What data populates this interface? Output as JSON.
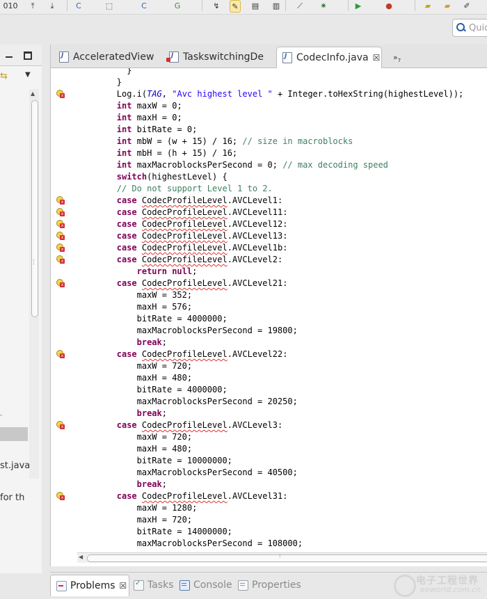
{
  "toolbar": {
    "items": [
      {
        "icon": "binary-icon",
        "glyph": "010"
      },
      {
        "icon": "upload-icon",
        "glyph": "⤒"
      },
      {
        "icon": "download-icon",
        "glyph": "⤓"
      },
      {
        "icon": "new-class-icon",
        "glyph": "C"
      },
      {
        "icon": "open-type-icon",
        "glyph": "⬚"
      },
      {
        "icon": "new-file-icon",
        "glyph": "C"
      },
      {
        "icon": "refresh-icon",
        "glyph": "G"
      },
      {
        "icon": "debug-step-icon",
        "glyph": "↯"
      },
      {
        "icon": "highlight-pen-icon",
        "glyph": "✎"
      },
      {
        "icon": "page-icon",
        "glyph": "▤"
      },
      {
        "icon": "stack-icon",
        "glyph": "▥"
      },
      {
        "icon": "pin-icon",
        "glyph": "⟋"
      },
      {
        "icon": "bug-icon",
        "glyph": "✷"
      },
      {
        "icon": "run-icon",
        "glyph": "▶"
      },
      {
        "icon": "stop-icon",
        "glyph": "●"
      },
      {
        "icon": "open-folder-icon",
        "glyph": "▰"
      },
      {
        "icon": "open-folder-alt-icon",
        "glyph": "▰"
      },
      {
        "icon": "edit-pencil-icon",
        "glyph": "✐"
      }
    ],
    "quick_access_placeholder": "Quic"
  },
  "left_view": {
    "item_truncated_1": "st.java",
    "item_truncated_2": "for th",
    "blue_mark": "-"
  },
  "editor": {
    "tabs": [
      {
        "label": "AcceleratedView",
        "error": false
      },
      {
        "label": "TaskswitchingDe",
        "error": true
      },
      {
        "label": "CodecInfo.java",
        "error": false,
        "active": true
      }
    ],
    "close_glyph": "☒",
    "overflow_label": "»",
    "overflow_count": "7",
    "lines": [
      {
        "indent": 10,
        "text": "        }"
      },
      {
        "indent": 8,
        "text": "}"
      },
      {
        "indent": 8,
        "marker": true,
        "html": "Log.i(<span class='it'>TAG</span>, <span class='st'>\"Avc highest level \"</span> + Integer.toHexString(highestLevel));"
      },
      {
        "indent": 8,
        "html": "<span class='kw'>int</span> maxW = 0;"
      },
      {
        "indent": 8,
        "html": "<span class='kw'>int</span> maxH = 0;"
      },
      {
        "indent": 8,
        "html": "<span class='kw'>int</span> bitRate = 0;"
      },
      {
        "indent": 8,
        "html": "<span class='kw'>int</span> mbW = (w + 15) / 16; <span class='cm'>// size in macroblocks</span>"
      },
      {
        "indent": 8,
        "html": "<span class='kw'>int</span> mbH = (h + 15) / 16;"
      },
      {
        "indent": 8,
        "html": "<span class='kw'>int</span> maxMacroblocksPerSecond = 0; <span class='cm'>// max decoding speed</span>"
      },
      {
        "indent": 8,
        "html": "<span class='kw'>switch</span>(highestLevel) {"
      },
      {
        "indent": 8,
        "html": "<span class='cm'>// Do not support Level 1 to 2.</span>"
      },
      {
        "indent": 8,
        "marker": true,
        "html": "<span class='kw'>case</span> <span class='sq'>CodecProfileLevel</span>.AVCLevel1:"
      },
      {
        "indent": 8,
        "marker": true,
        "html": "<span class='kw'>case</span> <span class='sq'>CodecProfileLevel</span>.AVCLevel11:"
      },
      {
        "indent": 8,
        "marker": true,
        "html": "<span class='kw'>case</span> <span class='sq'>CodecProfileLevel</span>.AVCLevel12:"
      },
      {
        "indent": 8,
        "marker": true,
        "html": "<span class='kw'>case</span> <span class='sq'>CodecProfileLevel</span>.AVCLevel13:"
      },
      {
        "indent": 8,
        "marker": true,
        "html": "<span class='kw'>case</span> <span class='sq'>CodecProfileLevel</span>.AVCLevel1b:"
      },
      {
        "indent": 8,
        "marker": true,
        "html": "<span class='kw'>case</span> <span class='sq'>CodecProfileLevel</span>.AVCLevel2:"
      },
      {
        "indent": 12,
        "html": "<span class='kw'>return null</span>;"
      },
      {
        "indent": 8,
        "marker": true,
        "html": "<span class='kw'>case</span> <span class='sq'>CodecProfileLevel</span>.AVCLevel21:"
      },
      {
        "indent": 12,
        "html": "maxW = 352;"
      },
      {
        "indent": 12,
        "html": "maxH = 576;"
      },
      {
        "indent": 12,
        "html": "bitRate = 4000000;"
      },
      {
        "indent": 12,
        "html": "maxMacroblocksPerSecond = 19800;"
      },
      {
        "indent": 12,
        "html": "<span class='kw'>break</span>;"
      },
      {
        "indent": 8,
        "marker": true,
        "html": "<span class='kw'>case</span> <span class='sq'>CodecProfileLevel</span>.AVCLevel22:"
      },
      {
        "indent": 12,
        "html": "maxW = 720;"
      },
      {
        "indent": 12,
        "html": "maxH = 480;"
      },
      {
        "indent": 12,
        "html": "bitRate = 4000000;"
      },
      {
        "indent": 12,
        "html": "maxMacroblocksPerSecond = 20250;"
      },
      {
        "indent": 12,
        "html": "<span class='kw'>break</span>;"
      },
      {
        "indent": 8,
        "marker": true,
        "html": "<span class='kw'>case</span> <span class='sq'>CodecProfileLevel</span>.AVCLevel3:"
      },
      {
        "indent": 12,
        "html": "maxW = 720;"
      },
      {
        "indent": 12,
        "html": "maxH = 480;"
      },
      {
        "indent": 12,
        "html": "bitRate = 10000000;"
      },
      {
        "indent": 12,
        "html": "maxMacroblocksPerSecond = 40500;"
      },
      {
        "indent": 12,
        "html": "<span class='kw'>break</span>;"
      },
      {
        "indent": 8,
        "marker": true,
        "html": "<span class='kw'>case</span> <span class='sq'>CodecProfileLevel</span>.AVCLevel31:"
      },
      {
        "indent": 12,
        "html": "maxW = 1280;"
      },
      {
        "indent": 12,
        "html": "maxH = 720;"
      },
      {
        "indent": 12,
        "html": "bitRate = 14000000;"
      },
      {
        "indent": 12,
        "html": "maxMacroblocksPerSecond = 108000;"
      }
    ]
  },
  "bottom_panel": {
    "tabs": [
      {
        "label": "Problems",
        "icon": "problems-icon",
        "active": true
      },
      {
        "label": "Tasks",
        "icon": "tasks-icon"
      },
      {
        "label": "Console",
        "icon": "console-icon"
      },
      {
        "label": "Properties",
        "icon": "properties-icon"
      }
    ],
    "close_glyph": "☒"
  },
  "watermark": {
    "cn": "电子工程世界",
    "en": "eeworld.com.cn"
  },
  "colors": {
    "keyword": "#7f0055",
    "comment": "#3f7f5f",
    "string": "#2a00ff",
    "static_field": "#0000c0",
    "error_squiggle": "#dd3333"
  }
}
